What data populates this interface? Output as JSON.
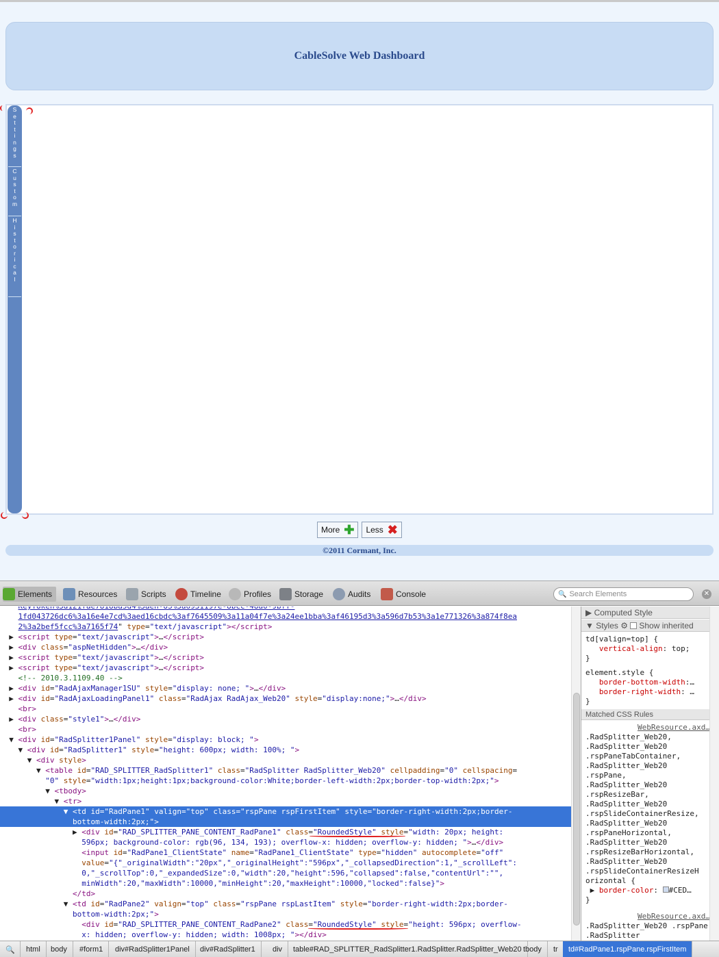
{
  "dashboard": {
    "title": "CableSolve Web Dashboard",
    "tabs": [
      {
        "label": "Settings"
      },
      {
        "label": "Custom"
      },
      {
        "label": "Historical"
      }
    ],
    "more_label": "More",
    "less_label": "Less",
    "copyright": "©2011 Cormant, Inc."
  },
  "devtools": {
    "tabs": [
      "Elements",
      "Resources",
      "Scripts",
      "Timeline",
      "Profiles",
      "Storage",
      "Audits",
      "Console"
    ],
    "search_placeholder": "Search Elements",
    "computed_style": "Computed Style",
    "styles": "Styles",
    "show_inherited": "Show inherited",
    "matched_rules": "Matched CSS Rules",
    "breadcrumbs": [
      "html",
      "body",
      "#form1",
      "div#RadSplitter1Panel",
      "div#RadSplitter1",
      "div",
      "table#RAD_SPLITTER_RadSplitter1.RadSplitter.RadSplitter_Web20",
      "tbody",
      "tr",
      "td#RadPane1.rspPane.rspFirstItem"
    ]
  },
  "colors": {
    "tab_strip": "#6086c1",
    "header_bg": "#c8dcf4",
    "selection": "#3875d7"
  }
}
